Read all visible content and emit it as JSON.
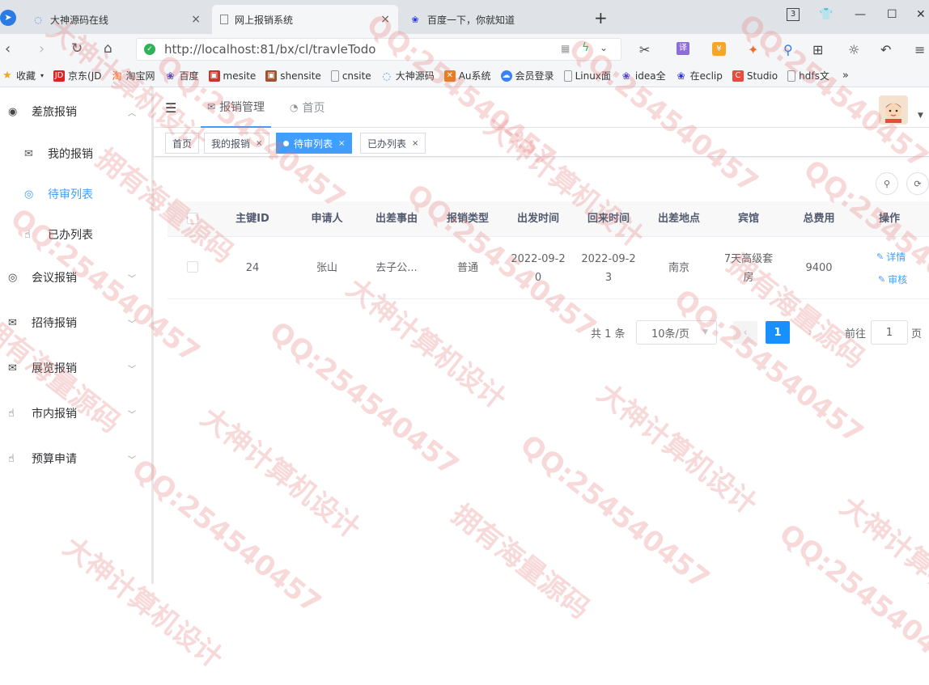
{
  "browser": {
    "tabs": [
      {
        "label": "大神源码在线"
      },
      {
        "label": "网上报销系统"
      },
      {
        "label": "百度一下，你就知道"
      }
    ],
    "tab_close": "×",
    "new_tab": "+",
    "url": "http://localhost:81/bx/cl/travleTodo",
    "badge": "3",
    "bookmarks": [
      "收藏",
      "京东(JD",
      "淘宝网",
      "百度",
      "mesite",
      "shensite",
      "cnsite",
      "大神源码",
      "Au系统",
      "会员登录",
      "Linux面",
      "idea全",
      "在eclip",
      "Studio",
      "hdfs文"
    ],
    "bookmarks_more": "»"
  },
  "sidebar": {
    "group1": "差旅报销",
    "sub": [
      {
        "label": "我的报销"
      },
      {
        "label": "待审列表"
      },
      {
        "label": "已办列表"
      }
    ],
    "groups": [
      "会议报销",
      "招待报销",
      "展览报销",
      "市内报销",
      "预算申请"
    ]
  },
  "topnav": {
    "menu1": "报销管理",
    "menu2": "首页"
  },
  "tags": [
    {
      "label": "首页"
    },
    {
      "label": "我的报销"
    },
    {
      "label": "待审列表"
    },
    {
      "label": "已办列表"
    }
  ],
  "tag_close": "×",
  "table": {
    "headers": [
      "主键ID",
      "申请人",
      "出差事由",
      "报销类型",
      "出发时间",
      "回来时间",
      "出差地点",
      "宾馆",
      "总费用",
      "操作"
    ],
    "rows": [
      {
        "id": "24",
        "applicant": "张山",
        "reason": "去子公...",
        "type": "普通",
        "depart_line1": "2022-09-2",
        "depart_line2": "0",
        "return_line1": "2022-09-2",
        "return_line2": "3",
        "location": "南京",
        "hotel_line1": "7天高级套",
        "hotel_line2": "房",
        "total": "9400",
        "op_detail": "详情",
        "op_audit": "审核"
      }
    ]
  },
  "pagination": {
    "total_text": "共 1 条",
    "page_size": "10条/页",
    "current_page": "1",
    "goto_prefix": "前往",
    "goto_value": "1",
    "goto_suffix": "页"
  },
  "watermarks": [
    "QQ:254540457",
    "大神计算机设计",
    "拥有海量源码"
  ],
  "colors": {
    "accent": "#409eff",
    "pager_active": "#1890ff",
    "watermark": "#e67878"
  }
}
